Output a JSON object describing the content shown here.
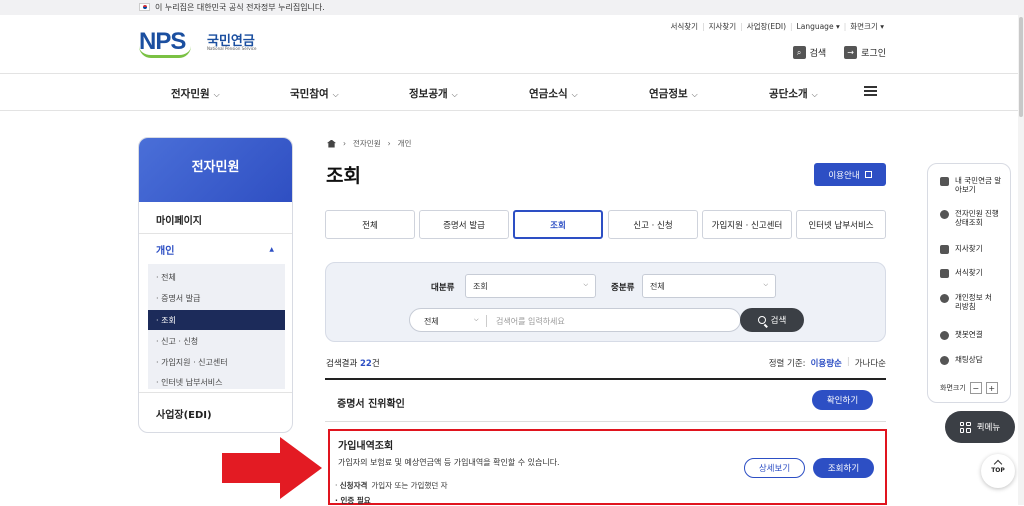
{
  "gov_banner": "이 누리집은 대한민국 공식 전자정부 누리집입니다.",
  "logo": {
    "mark": "NPS",
    "kr": "국민연금",
    "en": "National Pension Service"
  },
  "util_links": [
    "서식찾기",
    "지사찾기",
    "사업장(EDI)",
    "Language ▾",
    "화면크기 ▾"
  ],
  "header_buttons": {
    "search": "검색",
    "login": "로그인"
  },
  "gnb": [
    "전자민원",
    "국민참여",
    "정보공개",
    "연금소식",
    "연금정보",
    "공단소개"
  ],
  "lnb": {
    "title": "전자민원",
    "mypage": "마이페이지",
    "personal": "개인",
    "sub": [
      "· 전체",
      "· 증명서 발급",
      "· 조회",
      "· 신고 · 신청",
      "· 가입지원 · 신고센터",
      "· 인터넷 납부서비스"
    ],
    "edi": "사업장(EDI)"
  },
  "breadcrumb": [
    "전자민원",
    "개인"
  ],
  "page_title": "조회",
  "guide_button": "이용안내",
  "tabs": [
    "전체",
    "증명서 발급",
    "조회",
    "신고 · 신청",
    "가입지원 · 신고센터",
    "인터넷 납부서비스"
  ],
  "search": {
    "major_label": "대분류",
    "major_value": "조회",
    "minor_label": "중분류",
    "minor_value": "전체",
    "scope": "전체",
    "placeholder": "검색어를 입력하세요",
    "button": "검색"
  },
  "result": {
    "prefix": "검색결과",
    "count": "22",
    "suffix": "건",
    "sort_label": "정렬 기준:",
    "sort_options": [
      "이용량순",
      "가나다순"
    ]
  },
  "items": [
    {
      "title": "증명서 진위확인",
      "button": "확인하기"
    },
    {
      "title": "가입내역조회",
      "desc": "가입자의 보험료 및 예상연금액 등 가입내역을 확인할 수 있습니다.",
      "qual_label": "신청자격",
      "qual_value": "가입자 또는 가입했던 자",
      "auth": "· 인증 필요",
      "detail_button": "상세보기",
      "query_button": "조회하기"
    }
  ],
  "quick": {
    "items": [
      "내 국민연금 알아보기",
      "전자민원 진행상태조회",
      "지사찾기",
      "서식찾기",
      "개인정보 처리방침",
      "챗봇연결",
      "채팅상담"
    ],
    "zoom_label": "화면크기",
    "zoom_minus": "−",
    "zoom_plus": "+"
  },
  "quick_menu": "퀵메뉴",
  "top_button": "TOP"
}
